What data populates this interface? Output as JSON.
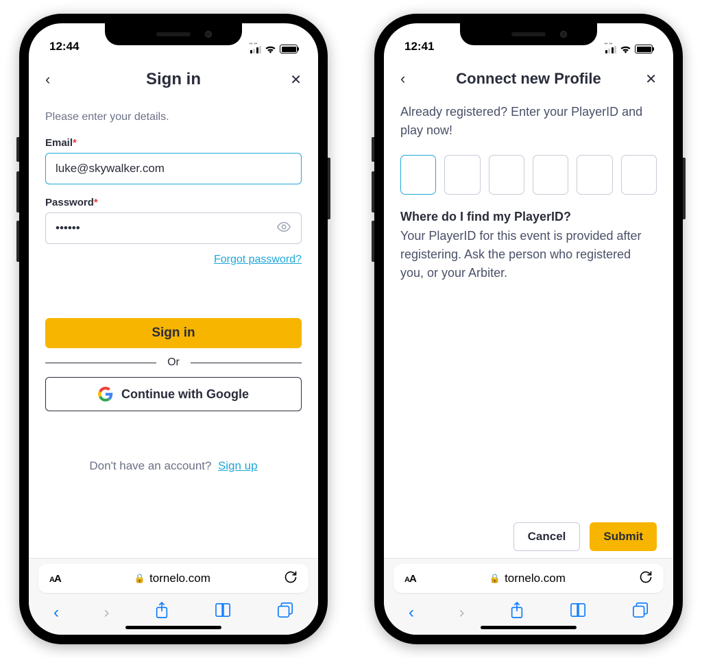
{
  "left": {
    "status_time": "12:44",
    "title": "Sign in",
    "subtitle": "Please enter your details.",
    "email_label": "Email",
    "email_value": "luke@skywalker.com",
    "password_label": "Password",
    "password_value": "••••••",
    "forgot_label": "Forgot password?",
    "signin_button": "Sign in",
    "or_label": "Or",
    "google_button": "Continue with Google",
    "no_account_text": "Don't have an account?",
    "signup_link": "Sign up",
    "url_text": "tornelo.com"
  },
  "right": {
    "status_time": "12:41",
    "title": "Connect new Profile",
    "intro": "Already registered? Enter your PlayerID and play now!",
    "help_q": "Where do I find my PlayerID?",
    "help_a": "Your PlayerID for this event is provided after registering. Ask the person who registered you, or your Arbiter.",
    "cancel_button": "Cancel",
    "submit_button": "Submit",
    "url_text": "tornelo.com"
  }
}
